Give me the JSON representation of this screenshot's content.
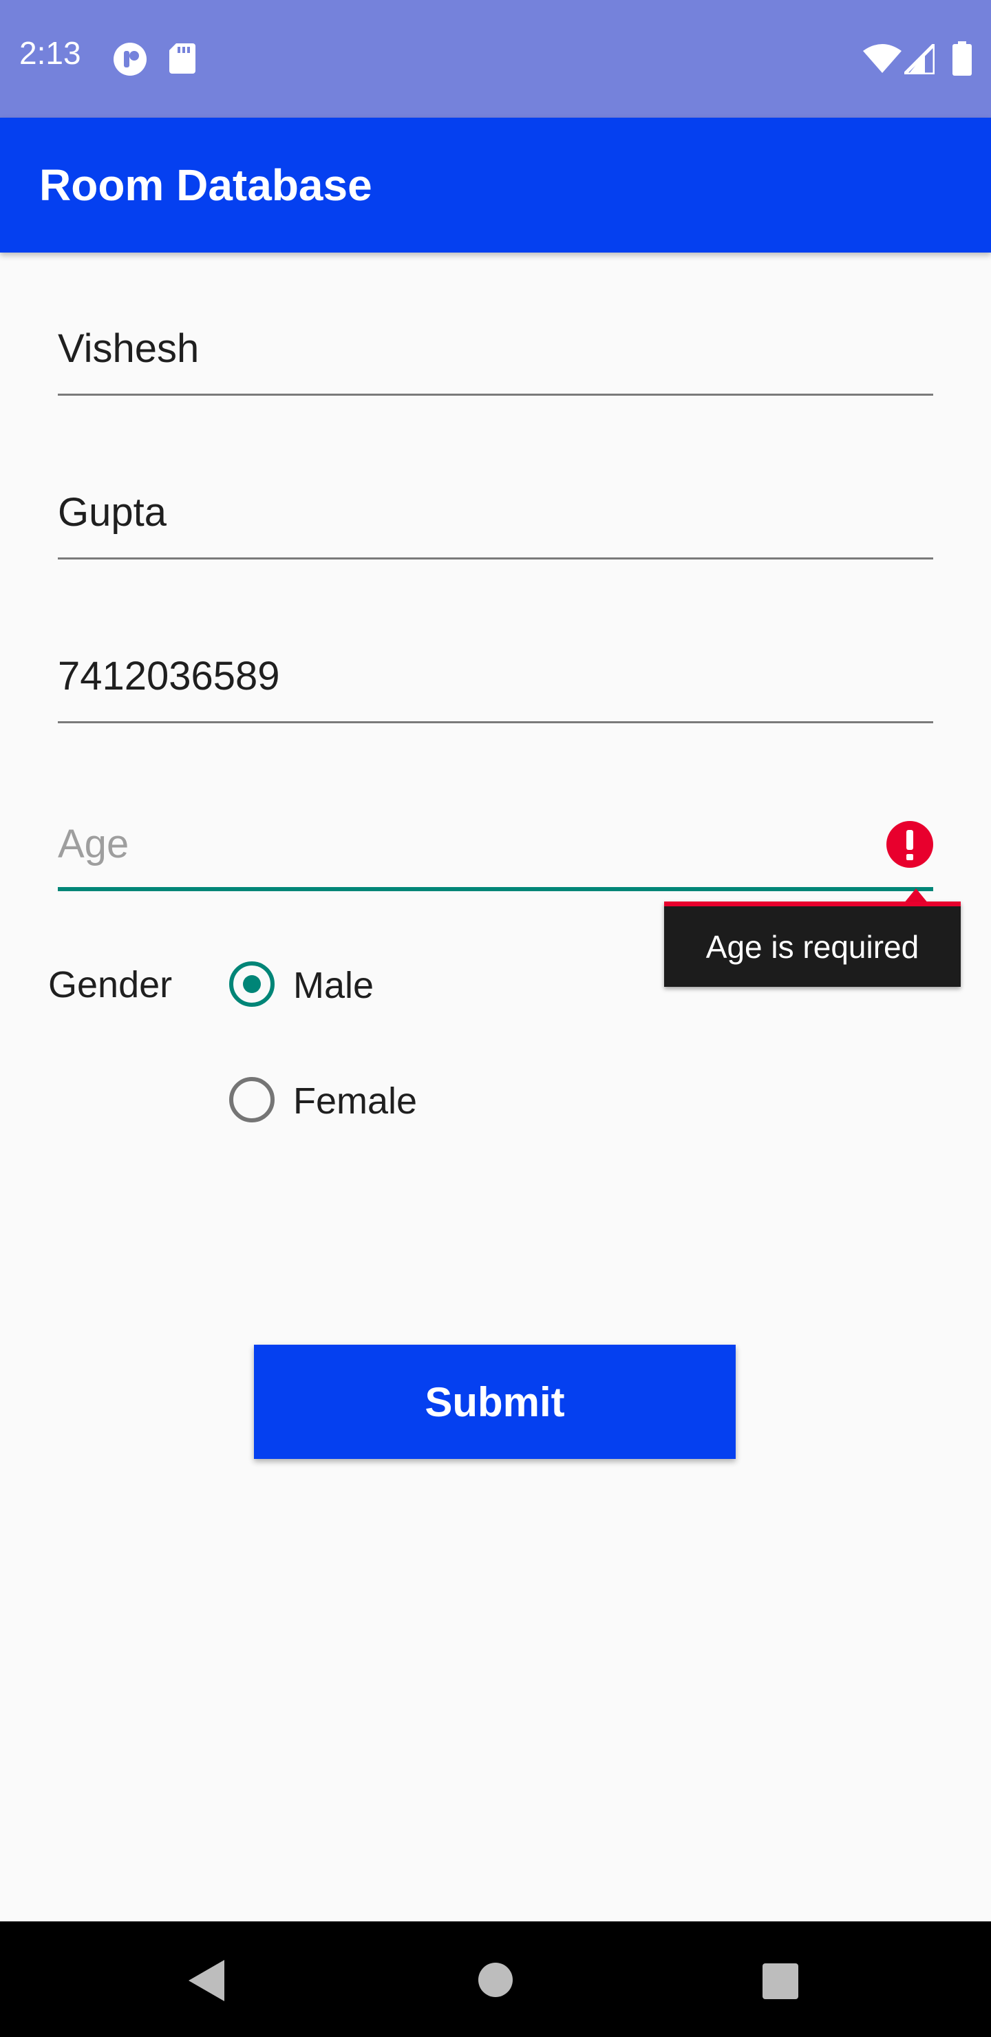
{
  "status_bar": {
    "time": "2:13",
    "left_icons": [
      "notification-app-icon",
      "sd-card-icon"
    ],
    "right_icons": [
      "wifi-icon",
      "signal-icon",
      "battery-icon"
    ],
    "color": "#7582db"
  },
  "app_bar": {
    "title": "Room Database",
    "color": "#0540f0"
  },
  "form": {
    "first_name": {
      "value": "Vishesh"
    },
    "last_name": {
      "value": "Gupta"
    },
    "phone": {
      "value": "7412036589"
    },
    "age": {
      "value": "",
      "placeholder": "Age",
      "error": "Age is required",
      "accent_color": "#008577",
      "error_color": "#e8002d"
    },
    "gender": {
      "label": "Gender",
      "options": [
        {
          "label": "Male",
          "checked": true
        },
        {
          "label": "Female",
          "checked": false
        }
      ]
    },
    "submit_label": "Submit"
  },
  "nav_bar": {
    "buttons": [
      "back-icon",
      "home-icon",
      "recents-icon"
    ]
  }
}
